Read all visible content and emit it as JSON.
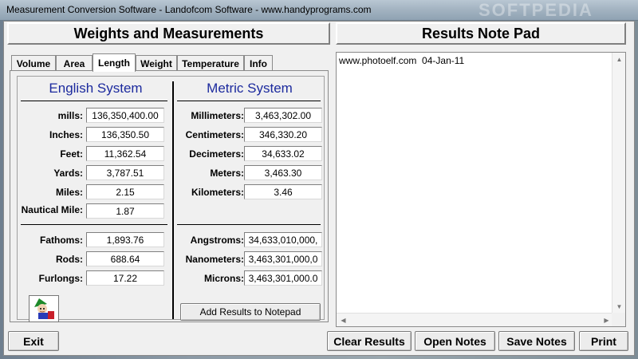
{
  "window": {
    "title": "Measurement Conversion Software - Landofcom Software - www.handyprograms.com",
    "watermark": "SOFTPEDIA"
  },
  "left_header": "Weights and Measurements",
  "right_header": "Results Note Pad",
  "tabs": [
    {
      "label": "Volume",
      "active": false
    },
    {
      "label": "Area",
      "active": false
    },
    {
      "label": "Length",
      "active": true
    },
    {
      "label": "Weight",
      "active": false
    },
    {
      "label": "Temperature",
      "active": false
    },
    {
      "label": "Info",
      "active": false
    }
  ],
  "english": {
    "title": "English System",
    "rows": [
      {
        "label": "mills:",
        "value": "136,350,400.00"
      },
      {
        "label": "Inches:",
        "value": "136,350.50"
      },
      {
        "label": "Feet:",
        "value": "11,362.54"
      },
      {
        "label": "Yards:",
        "value": "3,787.51"
      },
      {
        "label": "Miles:",
        "value": "2.15"
      },
      {
        "label": "Nautical Mile:",
        "value": "1.87"
      }
    ],
    "rows2": [
      {
        "label": "Fathoms:",
        "value": "1,893.76"
      },
      {
        "label": "Rods:",
        "value": "688.64"
      },
      {
        "label": "Furlongs:",
        "value": "17.22"
      }
    ]
  },
  "metric": {
    "title": "Metric System",
    "rows": [
      {
        "label": "Millimeters:",
        "value": "3,463,302.00"
      },
      {
        "label": "Centimeters:",
        "value": "346,330.20"
      },
      {
        "label": "Decimeters:",
        "value": "34,633.02"
      },
      {
        "label": "Meters:",
        "value": "3,463.30"
      },
      {
        "label": "Kilometers:",
        "value": "3.46"
      }
    ],
    "rows2": [
      {
        "label": "Angstroms:",
        "value": "34,633,010,000,"
      },
      {
        "label": "Nanometers:",
        "value": "3,463,301,000,0"
      },
      {
        "label": "Microns:",
        "value": "3,463,301,000.0"
      }
    ]
  },
  "add_button": "Add Results to Notepad",
  "notepad_text": "www.photoelf.com  04-Jan-11",
  "bottom_buttons": {
    "exit": "Exit",
    "clear": "Clear Results",
    "open": "Open Notes",
    "save": "Save Notes",
    "print": "Print"
  },
  "colors": {
    "system_title": "#1c2a9e",
    "client_bg": "#f0f0f0"
  }
}
